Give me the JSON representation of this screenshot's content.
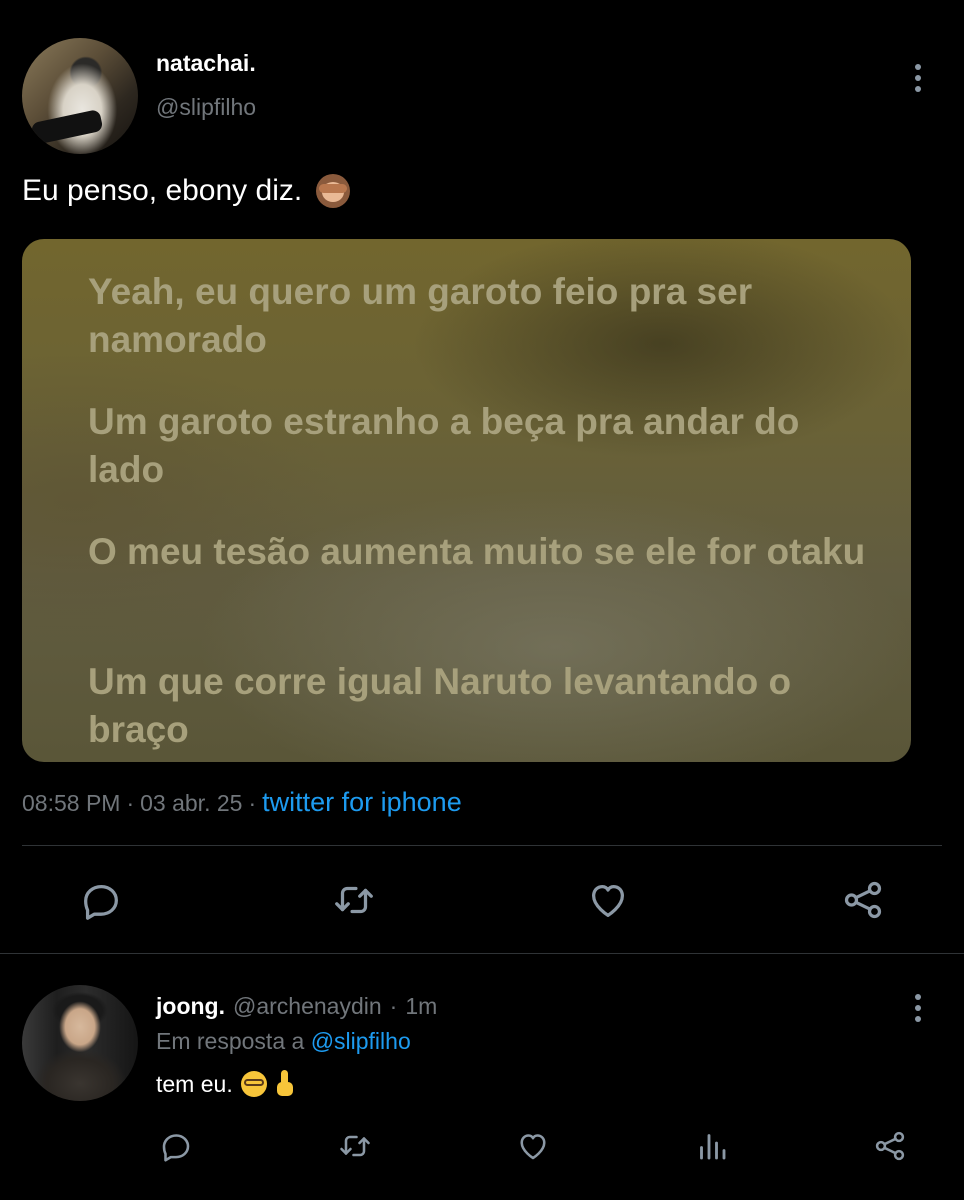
{
  "main_tweet": {
    "author_name": "natachai.",
    "author_handle": "@slipfilho",
    "text": "Eu penso, ebony diz.",
    "emoji": "see-no-evil-monkey",
    "media_lyrics": [
      "Yeah, eu quero um garoto feio pra ser namorado",
      "Um garoto estranho a beça pra andar do lado",
      "O meu tesão aumenta muito se ele for otaku",
      "Um que corre igual Naruto levantando o braço"
    ],
    "time": "08:58 PM",
    "date": "03 abr. 25",
    "separator": "·",
    "source": "twitter for iphone",
    "actions": [
      "reply-icon",
      "retweet-icon",
      "like-icon",
      "share-icon"
    ]
  },
  "reply_tweet": {
    "author_name": "joong.",
    "author_handle": "@archenaydin",
    "separator": "·",
    "age": "1m",
    "reply_prefix": "Em resposta a",
    "reply_to": "@slipfilho",
    "text": "tem eu.",
    "emojis": [
      "nerd-face",
      "index-pointing-up"
    ],
    "actions": [
      "reply-icon",
      "retweet-icon",
      "like-icon",
      "views-icon",
      "share-icon"
    ]
  },
  "colors": {
    "background": "#000000",
    "primary_text": "#e7e9ea",
    "secondary_text": "#71767b",
    "link": "#1d9bf0",
    "divider": "#2f3336",
    "icon": "#8b98a5"
  }
}
